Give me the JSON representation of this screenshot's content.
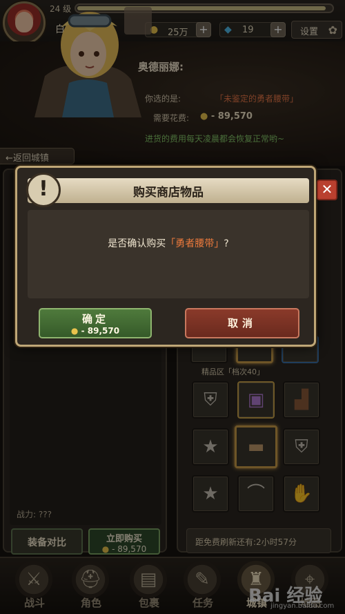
{
  "player": {
    "level": "24 级",
    "name": "白梦",
    "xp_fraction": 0.96
  },
  "currency": {
    "gold": "25万",
    "gems": "19"
  },
  "settings_label": "设置",
  "shopkeeper": {
    "name": "奥德丽娜:",
    "choice_label": "你选的是:",
    "choice_item": "「未鉴定的勇者腰带」",
    "cost_label": "需要花费:",
    "cost_value": "- 89,570",
    "restock_note": "进货的费用每天凌晨都会恢复正常哟~"
  },
  "back_label": "←返回城镇",
  "dialog": {
    "title": "购买商店物品",
    "message_pre": "是否确认购买",
    "message_item": "「勇者腰带」",
    "message_post": "?",
    "confirm_label": "确定",
    "confirm_cost": "- 89,570",
    "cancel_label": "取消"
  },
  "left_panel": {
    "power_label": "战力: ???",
    "compare_label": "装备对比",
    "buy_now_label": "立即购买",
    "buy_now_cost": "- 89,570"
  },
  "right_panel": {
    "tier_label": "精品区「档次40」",
    "refresh_label": "距免费刷新还有:2小时57分",
    "slots": [
      {
        "icon": "armor-icon"
      },
      {
        "icon": "treasure-chest-icon"
      },
      {
        "icon": "boots-icon"
      },
      {
        "icon": "star-bracer-icon"
      },
      {
        "icon": "belt-icon"
      },
      {
        "icon": "shoulder-armor-icon"
      },
      {
        "icon": "star-bracer-icon"
      },
      {
        "icon": "bow-icon"
      },
      {
        "icon": "gauntlet-icon"
      }
    ]
  },
  "nav": {
    "items": [
      {
        "label": "战斗",
        "icon": "crossed-swords-icon"
      },
      {
        "label": "角色",
        "icon": "helmet-icon"
      },
      {
        "label": "包裹",
        "icon": "backpack-icon"
      },
      {
        "label": "任务",
        "icon": "scroll-icon"
      },
      {
        "label": "城镇",
        "icon": "castle-icon"
      },
      {
        "label": "地图",
        "icon": "map-icon"
      }
    ],
    "active_index": 4
  },
  "watermark": {
    "logo": "Bai 经验",
    "sub": "jingyan.baidu.com"
  },
  "colors": {
    "highlight": "#ec7a3c",
    "confirm": "#4f7a3c",
    "cancel": "#8a3a2a",
    "note_green": "#86c86a"
  }
}
